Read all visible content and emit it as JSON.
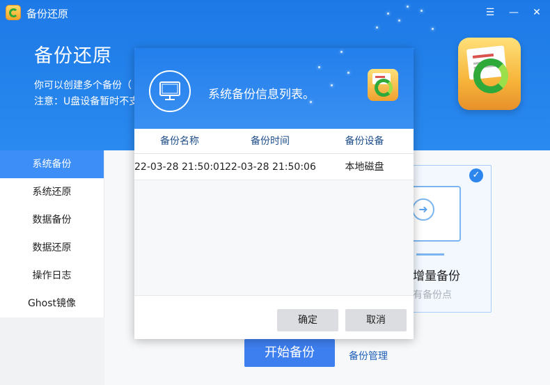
{
  "window": {
    "title": "备份还原",
    "controls": {
      "menu": "☰",
      "minimize": "—",
      "close": "✕"
    }
  },
  "hero": {
    "title": "备份还原",
    "line1": "你可以创建多个备份（",
    "line2": "注意：U盘设备暂时不支"
  },
  "sidebar": {
    "items": [
      {
        "label": "系统备份",
        "active": true
      },
      {
        "label": "系统还原",
        "active": false
      },
      {
        "label": "数据备份",
        "active": false
      },
      {
        "label": "数据还原",
        "active": false
      },
      {
        "label": "操作日志",
        "active": false
      },
      {
        "label": "Ghost镜像",
        "active": false
      }
    ]
  },
  "card": {
    "title": "增量备份",
    "subtitle": "有备份点",
    "check_icon": "check-icon",
    "arrow_icon": "arrow-right-icon"
  },
  "actions": {
    "start_label": "开始备份",
    "manage_label": "备份管理"
  },
  "modal": {
    "title": "系统备份信息列表。",
    "icon": "monitor-icon",
    "columns": [
      "备份名称",
      "备份时间",
      "备份设备"
    ],
    "rows": [
      [
        "22-03-28 21:50:01",
        "22-03-28 21:50:06",
        "本地磁盘"
      ]
    ],
    "ok_label": "确定",
    "cancel_label": "取消"
  },
  "colors": {
    "banner": "#1d79e6",
    "accent": "#3e8ef7",
    "button": "#3e7ff0",
    "modal_button": "#dcdde0"
  }
}
